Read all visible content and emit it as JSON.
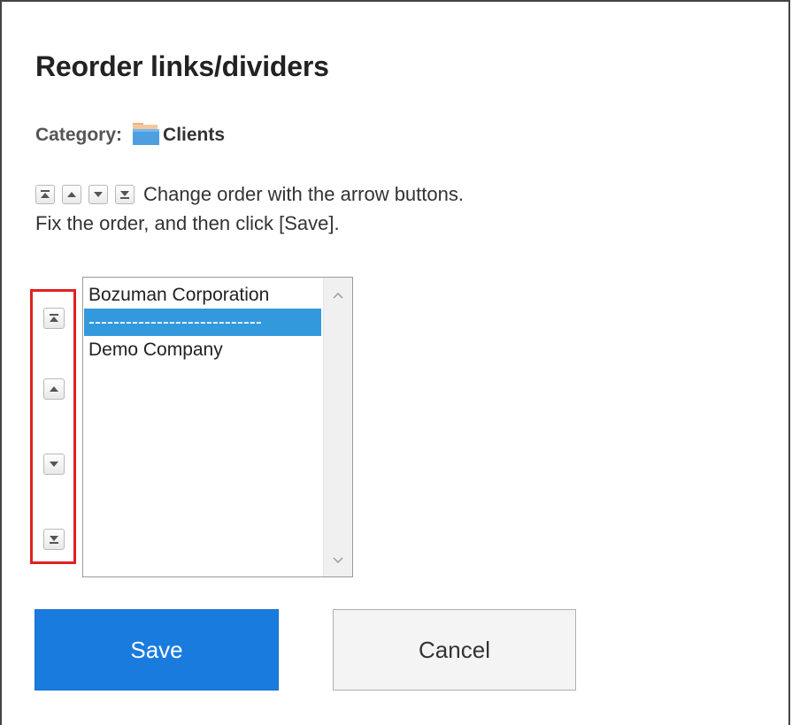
{
  "dialog": {
    "title": "Reorder links/dividers",
    "category_label": "Category:",
    "category_name": "Clients"
  },
  "instructions": {
    "line1": "Change order with the arrow buttons.",
    "line2": "Fix the order, and then click [Save]."
  },
  "move_buttons": [
    {
      "icon": "move-to-top-icon"
    },
    {
      "icon": "move-up-icon"
    },
    {
      "icon": "move-down-icon"
    },
    {
      "icon": "move-to-bottom-icon"
    }
  ],
  "list": {
    "items": [
      {
        "label": "Bozuman Corporation",
        "selected": false
      },
      {
        "label": "----------------------------",
        "selected": true
      },
      {
        "label": "Demo Company",
        "selected": false
      }
    ]
  },
  "buttons": {
    "save_label": "Save",
    "cancel_label": "Cancel"
  },
  "colors": {
    "accent": "#1a7bdf",
    "selected_bg": "#3399dd",
    "highlight_border": "#e02020"
  }
}
